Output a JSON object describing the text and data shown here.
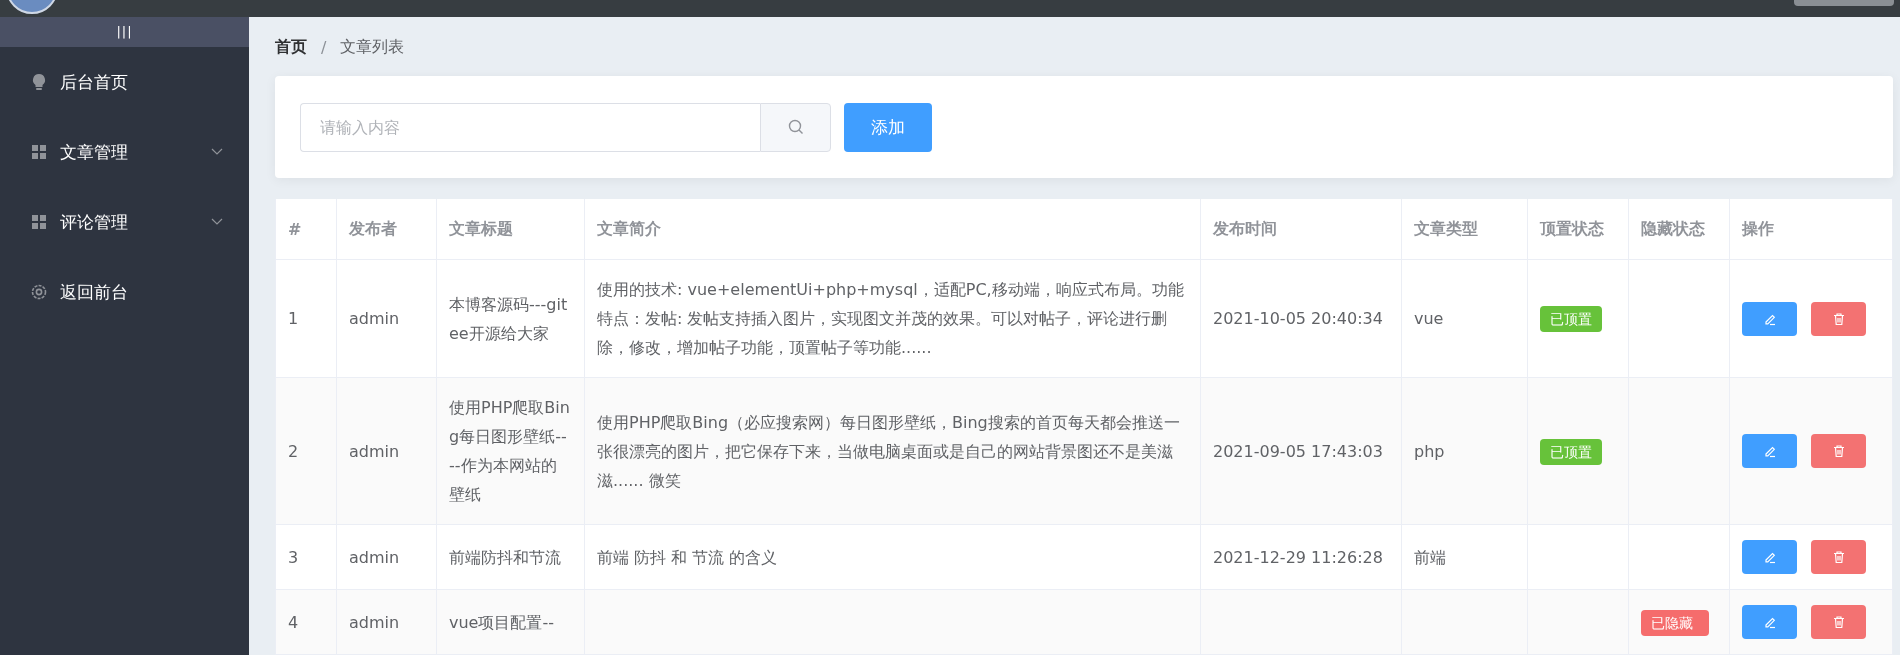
{
  "sidebar": {
    "toggle": "|||",
    "items": [
      {
        "label": "后台首页",
        "kind": "link",
        "selected": false
      },
      {
        "label": "文章管理",
        "kind": "submenu",
        "selected": false
      },
      {
        "label": "评论管理",
        "kind": "submenu",
        "selected": false
      },
      {
        "label": "返回前台",
        "kind": "link",
        "selected": false
      }
    ]
  },
  "breadcrumb": [
    {
      "label": "首页",
      "current": false
    },
    {
      "label": "文章列表",
      "current": true
    }
  ],
  "breadcrumb_separator": "/",
  "toolbar": {
    "search": {
      "placeholder": "请输入内容"
    },
    "add_button": "添加"
  },
  "table": {
    "columns": [
      "#",
      "发布者",
      "文章标题",
      "文章简介",
      "发布时间",
      "文章类型",
      "顶置状态",
      "隐藏状态",
      "操作"
    ],
    "rows": [
      {
        "index": "1",
        "author": "admin",
        "title": "本博客源码---gitee开源给大家",
        "summary": "使用的技术: vue+elementUi+php+mysql，适配PC,移动端，响应式布局。功能特点：发帖: 发帖支持插入图片，实现图文并茂的效果。可以对帖子，评论进行删除，修改，增加帖子功能，顶置帖子等功能......",
        "time": "2021-10-05 20:40:34",
        "type": "vue",
        "pinned": true,
        "pin_label": "已顶置",
        "hidden": false
      },
      {
        "index": "2",
        "author": "admin",
        "title": "使用PHP爬取Bing每日图形壁纸----作为本网站的壁纸",
        "summary": "使用PHP爬取Bing（必应搜索网）每日图形壁纸，Bing搜索的首页每天都会推送一张很漂亮的图片，把它保存下来，当做电脑桌面或是自己的网站背景图还不是美滋滋...... 微笑",
        "time": "2021-09-05 17:43:03",
        "type": "php",
        "pinned": true,
        "pin_label": "已顶置",
        "hidden": false
      },
      {
        "index": "3",
        "author": "admin",
        "title": "前端防抖和节流",
        "summary": "前端 防抖 和 节流 的含义",
        "time": "2021-12-29 11:26:28",
        "type": "前端",
        "pinned": false,
        "hidden": false
      },
      {
        "index": "4",
        "author": "admin",
        "title": "vue项目配置--",
        "pinned": false,
        "hidden": true,
        "hid_label": "已隐藏"
      }
    ]
  }
}
